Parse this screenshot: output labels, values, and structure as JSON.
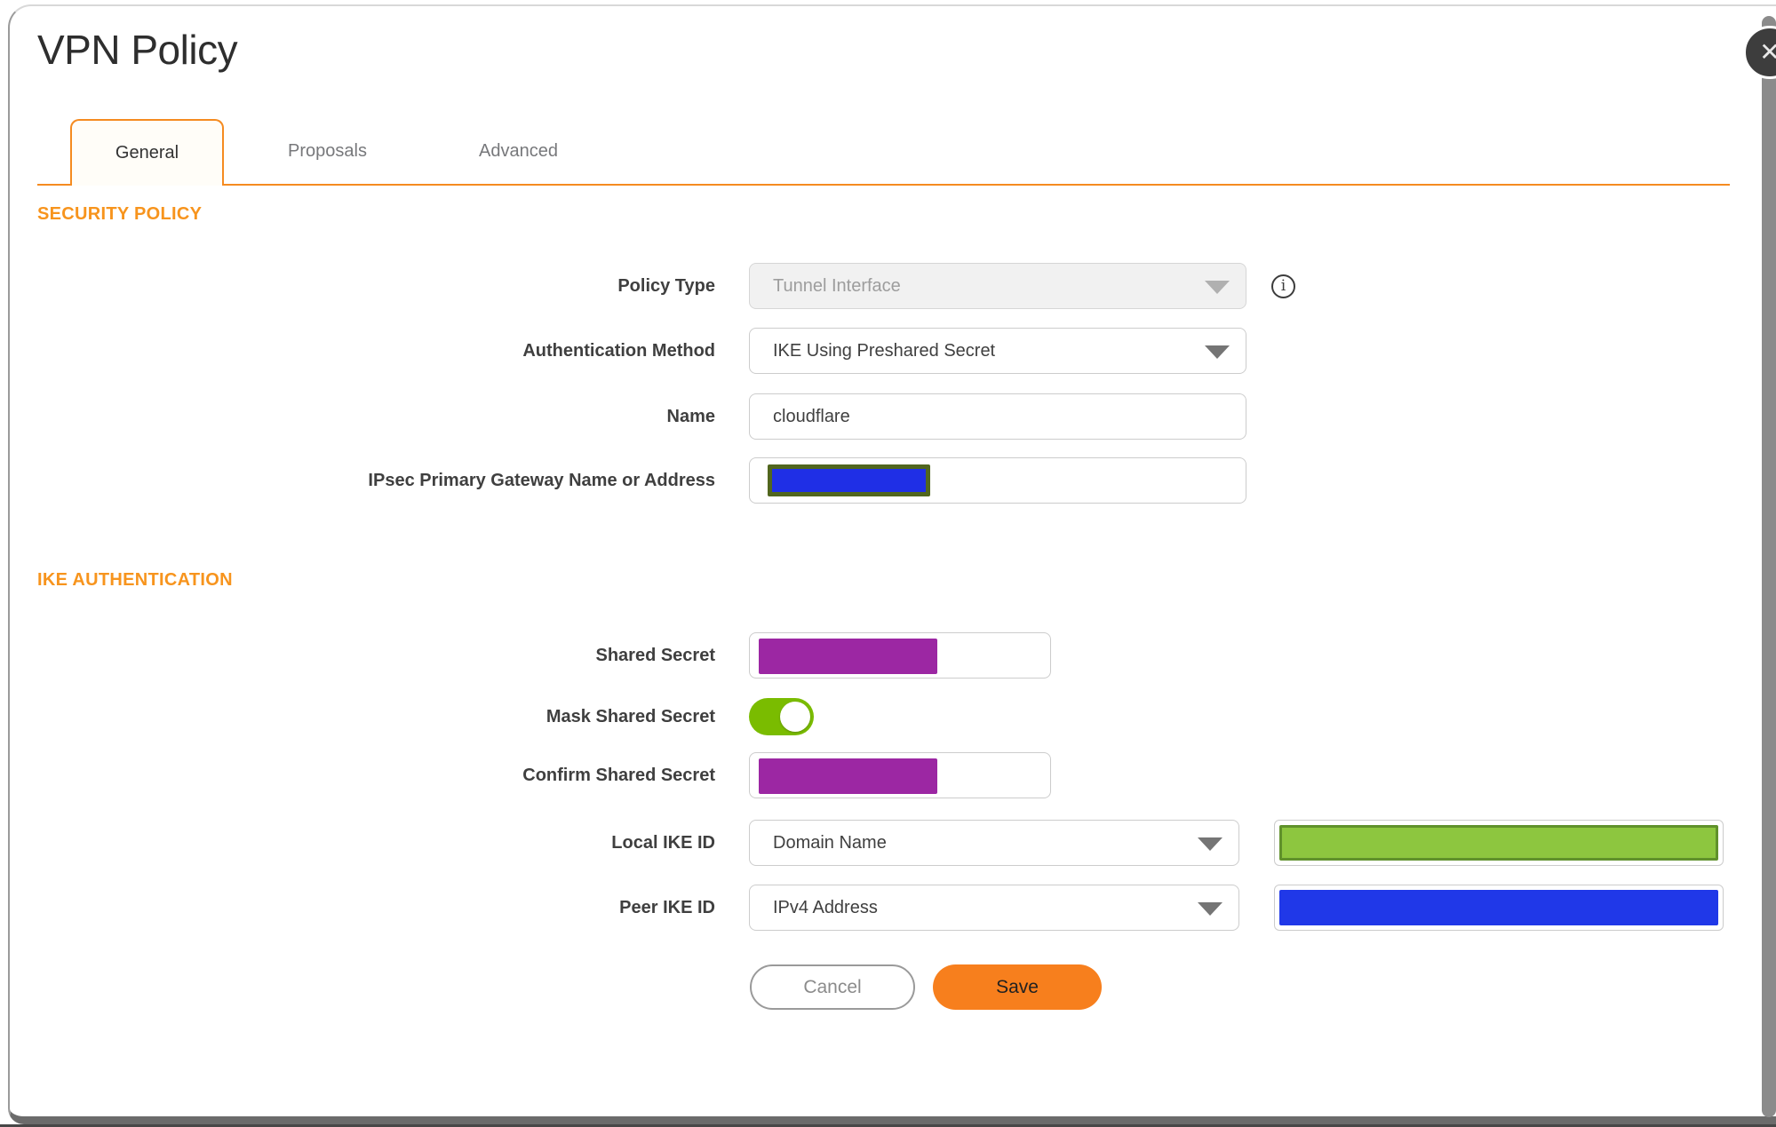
{
  "dialog": {
    "title": "VPN Policy",
    "close_glyph": "✕"
  },
  "tabs": [
    {
      "label": "General",
      "active": true
    },
    {
      "label": "Proposals",
      "active": false
    },
    {
      "label": "Advanced",
      "active": false
    }
  ],
  "sections": {
    "security_policy": "SECURITY POLICY",
    "ike_authentication": "IKE AUTHENTICATION"
  },
  "fields": {
    "policy_type": {
      "label": "Policy Type",
      "value": "Tunnel Interface",
      "disabled": true
    },
    "auth_method": {
      "label": "Authentication Method",
      "value": "IKE Using Preshared Secret"
    },
    "name": {
      "label": "Name",
      "value": "cloudflare"
    },
    "gateway": {
      "label": "IPsec Primary Gateway Name or Address",
      "value_masked": true
    },
    "shared_secret": {
      "label": "Shared Secret",
      "value_masked": true
    },
    "mask_shared_secret": {
      "label": "Mask Shared Secret",
      "state": "on"
    },
    "confirm_shared_secret": {
      "label": "Confirm Shared Secret",
      "value_masked": true
    },
    "local_ike_id": {
      "label": "Local IKE ID",
      "value": "Domain Name",
      "id_value_masked": true
    },
    "peer_ike_id": {
      "label": "Peer IKE ID",
      "value": "IPv4 Address",
      "id_value_masked": true
    }
  },
  "info_icon_glyph": "i",
  "buttons": {
    "cancel": "Cancel",
    "save": "Save"
  },
  "colors": {
    "accent_orange": "#F7941D",
    "tab_border_orange": "#F58B20",
    "save_button_orange": "#F77F1D",
    "toggle_on_green": "#7ABC00",
    "redaction_purple": "#9C27A3",
    "redaction_blue": "#2038E8",
    "redaction_green": "#8DC63F",
    "redaction_green_border": "#60912B",
    "redaction_olive_border": "#51661E"
  }
}
